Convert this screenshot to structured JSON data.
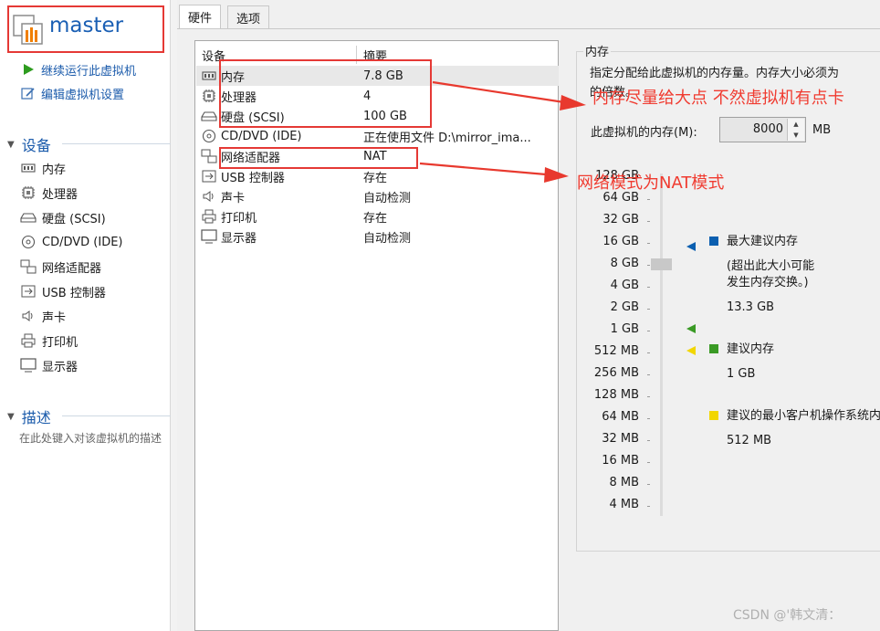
{
  "vm": {
    "name": "master"
  },
  "actions": [
    {
      "label": "继续运行此虚拟机",
      "icon": "play-icon"
    },
    {
      "label": "编辑虚拟机设置",
      "icon": "edit-settings-icon"
    }
  ],
  "sidebar": {
    "devices_title": "设备",
    "devices": [
      {
        "label": "内存",
        "icon": "memory-icon"
      },
      {
        "label": "处理器",
        "icon": "cpu-icon"
      },
      {
        "label": "硬盘 (SCSI)",
        "icon": "hard-disk-icon"
      },
      {
        "label": "CD/DVD (IDE)",
        "icon": "cd-dvd-icon"
      },
      {
        "label": "网络适配器",
        "icon": "network-adapter-icon"
      },
      {
        "label": "USB 控制器",
        "icon": "usb-icon"
      },
      {
        "label": "声卡",
        "icon": "sound-card-icon"
      },
      {
        "label": "打印机",
        "icon": "printer-icon"
      },
      {
        "label": "显示器",
        "icon": "display-icon"
      }
    ],
    "description_title": "描述",
    "description_hint": "在此处键入对该虚拟机的描述"
  },
  "tabs": [
    {
      "label": "硬件",
      "active": true
    },
    {
      "label": "选项",
      "active": false
    }
  ],
  "table": {
    "headers": [
      "设备",
      "摘要"
    ],
    "rows": [
      {
        "device": "内存",
        "summary": "7.8 GB",
        "icon": "memory-icon",
        "selected": true
      },
      {
        "device": "处理器",
        "summary": "4",
        "icon": "cpu-icon"
      },
      {
        "device": "硬盘 (SCSI)",
        "summary": "100 GB",
        "icon": "hard-disk-icon"
      },
      {
        "device": "CD/DVD (IDE)",
        "summary": "正在使用文件 D:\\mirror_ima...",
        "icon": "cd-dvd-icon"
      },
      {
        "device": "网络适配器",
        "summary": "NAT",
        "icon": "network-adapter-icon"
      },
      {
        "device": "USB 控制器",
        "summary": "存在",
        "icon": "usb-icon"
      },
      {
        "device": "声卡",
        "summary": "自动检测",
        "icon": "sound-card-icon"
      },
      {
        "device": "打印机",
        "summary": "存在",
        "icon": "printer-icon"
      },
      {
        "device": "显示器",
        "summary": "自动检测",
        "icon": "display-icon"
      }
    ]
  },
  "memory": {
    "title": "内存",
    "description_line1": "指定分配给此虚拟机的内存量。内存大小必须为",
    "description_line2": "的倍数。",
    "field_label": "此虚拟机的内存(M):",
    "value": "8000",
    "unit": "MB",
    "scale": [
      "128 GB",
      "64 GB",
      "32 GB",
      "16 GB",
      "8 GB",
      "4 GB",
      "2 GB",
      "1 GB",
      "512 MB",
      "256 MB",
      "128 MB",
      "64 MB",
      "32 MB",
      "16 MB",
      "8 MB",
      "4 MB"
    ],
    "legend": {
      "max_title": "最大建议内存",
      "max_note_line1": "(超出此大小可能",
      "max_note_line2": "发生内存交换。)",
      "max_value": "13.3 GB",
      "rec_title": "建议内存",
      "rec_value": "1 GB",
      "min_title": "建议的最小客户机操作系统内存",
      "min_value": "512 MB"
    },
    "colors": {
      "max": "#0b5fb0",
      "recommended": "#3a9a25",
      "min": "#f2d600"
    }
  },
  "annotations": {
    "memory_note": "内存尽量给大点 不然虚拟机有点卡",
    "network_note": "网络模式为NAT模式"
  },
  "watermark": "CSDN @'韩文清："
}
